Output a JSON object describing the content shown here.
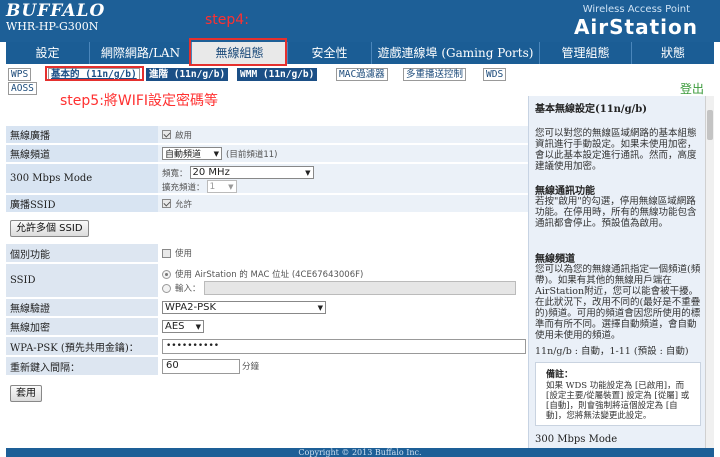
{
  "header": {
    "brand": "BUFFALO",
    "model": "WHR-HP-G300N",
    "product_line": "Wireless Access Point",
    "product_name": "AirStation"
  },
  "nav": [
    {
      "label": "設定"
    },
    {
      "label": "網際網路/LAN"
    },
    {
      "label": "無線組態"
    },
    {
      "label": "安全性"
    },
    {
      "label": "遊戲連線埠 (Gaming Ports)"
    },
    {
      "label": "管理組態"
    },
    {
      "label": "狀態"
    }
  ],
  "subtabs": [
    "WPS",
    "基本的 (11n/g/b)",
    "進階 (11n/g/b)",
    "WMM (11n/g/b)",
    "MAC過濾器",
    "多重播送控制",
    "WDS",
    "AOSS"
  ],
  "logout": "登出",
  "annotations": {
    "step4": "step4:",
    "step5": "step5:將WIFI設定密碼等"
  },
  "form1": {
    "broadcast_label": "無線廣播",
    "broadcast_value": "啟用",
    "channel_label": "無線頻道",
    "channel_value": "自動頻道",
    "channel_current": "(目前頻道11)",
    "mode_label": "300 Mbps Mode",
    "bandwidth_label": "頻寬：",
    "bandwidth_value": "20 MHz",
    "ext_channel_label": "擴充頻道：",
    "ext_channel_value": "1",
    "ssid_broadcast_label": "廣播SSID",
    "ssid_broadcast_value": "允許"
  },
  "multi_ssid_button": "允許多個 SSID",
  "form2": {
    "separate_label": "個別功能",
    "separate_value": "使用",
    "ssid_label": "SSID",
    "ssid_opt1": "使用 AirStation 的 MAC 位址 (4CE67643006F)",
    "ssid_opt2": "輸入：",
    "auth_label": "無線驗證",
    "auth_value": "WPA2-PSK",
    "enc_label": "無線加密",
    "enc_value": "AES",
    "psk_label": "WPA-PSK (預先共用金鑰)：",
    "psk_value": "••••••••••",
    "rekey_label": "重新鍵入間隔：",
    "rekey_value": "60",
    "rekey_unit": "分鐘"
  },
  "apply_button": "套用",
  "help": {
    "title1": "基本無線設定(11n/g/b)",
    "text1": "您可以對您的無線區域網路的基本組態資訊進行手動設定。如果未使用加密，會以此基本設定進行通訊。然而，高度建議使用加密。",
    "title2": "無線通訊功能",
    "text2": "若按\"啟用\"的勾選，停用無線區域網路功能。在停用時，所有的無線功能包含通訊都會停止。預設值為啟用。",
    "title3": "無線頻道",
    "text3": "您可以為您的無線通訊指定一個頻道(頻帶)。如果有其他的無線用戶端在AirStation附近，您可以能會被干擾。在此狀況下，改用不同的(最好是不重疊的)頻道。可用的頻道會因您所使用的標準而有所不同。選擇自動頻道，會自動使用未使用的頻道。",
    "channel_range": "11n/g/b : 自動，1-11 (預設 : 自動)",
    "note_title": "備註：",
    "note_text": "如果 WDS 功能設定為 [已啟用]，而 [設定主要/從屬裝置] 設定為 [從屬] 或 [自動]，則會強制將這個設定為 [自動]，您將無法變更此設定。",
    "title4": "300 Mbps Mode"
  },
  "footer": "Copyright © 2013 Buffalo Inc."
}
